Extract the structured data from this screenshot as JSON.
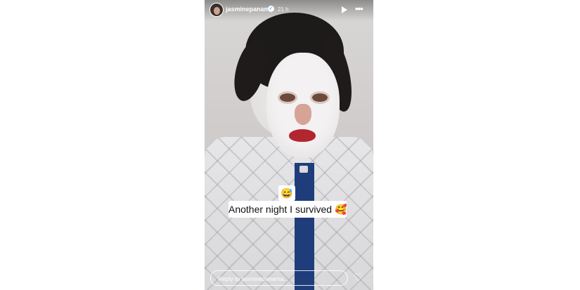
{
  "header": {
    "username": "jasminepanama",
    "verified_icon": "verified-badge-icon",
    "time": "21 h",
    "play_icon": "play-icon",
    "more_icon": "more-options-icon"
  },
  "stickers": {
    "emoji": "😅",
    "caption": "Another night I survived 🥰"
  },
  "reply": {
    "placeholder": "Reply to jasminepanama...",
    "like_icon": "heart-icon"
  }
}
